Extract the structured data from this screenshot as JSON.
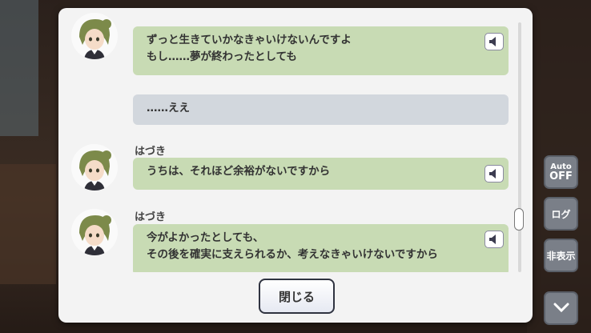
{
  "log": {
    "entries": [
      {
        "type": "dialogue",
        "speaker": "",
        "lines": [
          "ずっと生きていかなきゃいけないんですよ",
          "もし……夢が終わったとしても"
        ]
      },
      {
        "type": "narration",
        "speaker": "",
        "lines": [
          "……ええ"
        ]
      },
      {
        "type": "dialogue",
        "speaker": "はづき",
        "lines": [
          "うちは、それほど余裕がないですから"
        ]
      },
      {
        "type": "dialogue",
        "speaker": "はづき",
        "lines": [
          "今がよかったとしても、",
          "その後を確実に支えられるか、考えなきゃいけないですから"
        ]
      }
    ],
    "close_label": "閉じる"
  },
  "side_controls": {
    "auto_top": "Auto",
    "auto_bottom": "OFF",
    "log_label": "ログ",
    "hide_label": "非表示"
  },
  "icons": {
    "voice": "speaker-icon",
    "chevron": "chevron-down-icon"
  },
  "colors": {
    "dialogue_bubble": "#c8dbb4",
    "narration_bubble": "#d2d7dd",
    "panel": "#f3f3f3"
  }
}
